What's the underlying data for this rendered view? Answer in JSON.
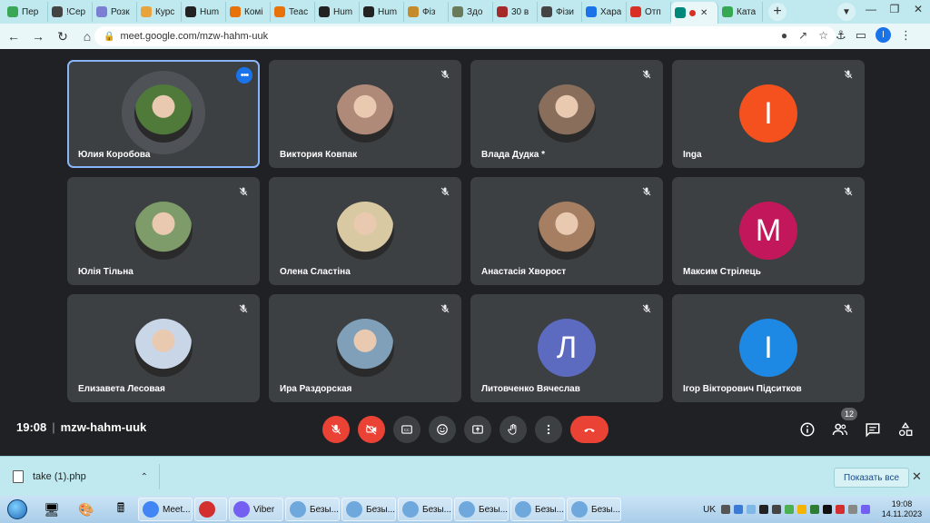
{
  "browser": {
    "tabs": [
      {
        "label": "Пер",
        "color": "#3aa757"
      },
      {
        "label": "!Сер",
        "color": "#444444"
      },
      {
        "label": "Розк",
        "color": "#7b7fd4"
      },
      {
        "label": "Курс",
        "color": "#e8a33d"
      },
      {
        "label": "Hum",
        "color": "#222222"
      },
      {
        "label": "Комі",
        "color": "#e8710a"
      },
      {
        "label": "Teac",
        "color": "#e8710a"
      },
      {
        "label": "Hum",
        "color": "#222222"
      },
      {
        "label": "Hum",
        "color": "#222222"
      },
      {
        "label": "Фіз",
        "color": "#c58b2a"
      },
      {
        "label": "Здо",
        "color": "#6a7b5a"
      },
      {
        "label": "30 в",
        "color": "#a52a2a"
      },
      {
        "label": "Фізи",
        "color": "#444444"
      },
      {
        "label": "Хара",
        "color": "#1a73e8"
      },
      {
        "label": "Отп",
        "color": "#d93025"
      },
      {
        "label": "",
        "color": "#00897b",
        "active": true
      },
      {
        "label": "Ката",
        "color": "#34a853"
      }
    ],
    "url": "meet.google.com/mzw-hahm-uuk",
    "profile_initial": "I"
  },
  "meeting": {
    "time": "19:08",
    "code": "mzw-hahm-uuk",
    "people_count": "12",
    "participants": [
      {
        "name": "Юлия Коробова",
        "type": "photo",
        "color": "#4f7a3a",
        "speaking": true,
        "muted": false
      },
      {
        "name": "Виктория Ковпак",
        "type": "photo",
        "color": "#b08a78",
        "muted": true
      },
      {
        "name": "Влада Дудка *",
        "type": "photo",
        "color": "#8a6e5c",
        "muted": true
      },
      {
        "name": "Inga",
        "type": "letter",
        "letter": "I",
        "color": "#f4511e",
        "muted": true
      },
      {
        "name": "Юлія Тільна",
        "type": "photo",
        "color": "#7e9b6a",
        "muted": true
      },
      {
        "name": "Олена Сластіна",
        "type": "photo",
        "color": "#d9c9a3",
        "muted": true
      },
      {
        "name": "Анастасія Хворост",
        "type": "photo",
        "color": "#a67f63",
        "muted": true
      },
      {
        "name": "Максим Стрілець",
        "type": "letter",
        "letter": "М",
        "color": "#c2185b",
        "muted": true
      },
      {
        "name": "Елизавета Лесовая",
        "type": "photo",
        "color": "#c9d6e8",
        "muted": true
      },
      {
        "name": "Ира Раздорская",
        "type": "photo",
        "color": "#7fa0b8",
        "muted": true
      },
      {
        "name": "Литовченко Вячеслав",
        "type": "letter",
        "letter": "Л",
        "color": "#5c6bc0",
        "muted": true
      },
      {
        "name": "Ігор Вікторович Підситков",
        "type": "letter",
        "letter": "І",
        "color": "#1e88e5",
        "muted": true
      }
    ]
  },
  "downloads": {
    "file": "take (1).php",
    "show_all": "Показать все"
  },
  "taskbar": {
    "buttons": [
      {
        "label": "Meet...",
        "color": "#4285f4"
      },
      {
        "label": "",
        "color": "#d32f2f"
      },
      {
        "label": "Viber",
        "color": "#7360f2"
      },
      {
        "label": "Безы...",
        "color": "#6fa8dc"
      },
      {
        "label": "Безы...",
        "color": "#6fa8dc"
      },
      {
        "label": "Безы...",
        "color": "#6fa8dc"
      },
      {
        "label": "Безы...",
        "color": "#6fa8dc"
      },
      {
        "label": "Безы...",
        "color": "#6fa8dc"
      },
      {
        "label": "Безы...",
        "color": "#6fa8dc"
      }
    ],
    "lang": "UK",
    "time": "19:08",
    "date": "14.11.2023"
  }
}
